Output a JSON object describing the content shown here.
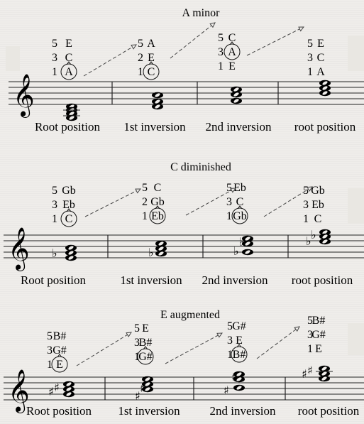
{
  "sections": [
    {
      "title": "A minor",
      "positions": [
        {
          "label": "Root position",
          "numbers": [
            "5",
            "3",
            "1"
          ],
          "notes": [
            "E",
            "C",
            "A"
          ],
          "circled": "A"
        },
        {
          "label": "1st inversion",
          "numbers": [
            "5",
            "2",
            "1"
          ],
          "notes": [
            "A",
            "E",
            "C"
          ],
          "circled": "C"
        },
        {
          "label": "2nd inversion",
          "numbers": [
            "5",
            "3",
            "1"
          ],
          "notes": [
            "C",
            "A",
            "E"
          ],
          "circled": "A"
        },
        {
          "label": "root position",
          "numbers": [
            "5",
            "3",
            "1"
          ],
          "notes": [
            "E",
            "C",
            "A"
          ],
          "circled": null
        }
      ]
    },
    {
      "title": "C diminished",
      "positions": [
        {
          "label": "Root position",
          "numbers": [
            "5",
            "3",
            "1"
          ],
          "notes": [
            "Gb",
            "Eb",
            "C"
          ],
          "circled": "C"
        },
        {
          "label": "1st inversion",
          "numbers": [
            "5",
            "2",
            "1"
          ],
          "notes": [
            "C",
            "Gb",
            "Eb"
          ],
          "circled": "Eb"
        },
        {
          "label": "2nd inversion",
          "numbers": [
            "5",
            "3",
            "1"
          ],
          "notes": [
            "Eb",
            "C",
            "Gb"
          ],
          "circled": "Gb"
        },
        {
          "label": "root position",
          "numbers": [
            "5",
            "3",
            "1"
          ],
          "notes": [
            "Gb",
            "Eb",
            "C"
          ],
          "circled": null
        }
      ]
    },
    {
      "title": "E augmented",
      "positions": [
        {
          "label": "Root position",
          "numbers": [
            "5",
            "3",
            "1"
          ],
          "notes": [
            "B#",
            "G#",
            "E"
          ],
          "circled": "E"
        },
        {
          "label": "1st inversion",
          "numbers": [
            "5",
            "3",
            "1"
          ],
          "notes": [
            "E",
            "B#",
            "G#"
          ],
          "circled": "G#"
        },
        {
          "label": "2nd inversion",
          "numbers": [
            "5",
            "3",
            "1"
          ],
          "notes": [
            "G#",
            "E",
            "B#"
          ],
          "circled": "B#"
        },
        {
          "label": "root position",
          "numbers": [
            "5",
            "3",
            "1"
          ],
          "notes": [
            "B#",
            "G#",
            "E"
          ],
          "circled": null
        }
      ]
    }
  ],
  "symbols": {
    "clef": "𝄞",
    "flat": "♭",
    "sharp": "♯"
  }
}
